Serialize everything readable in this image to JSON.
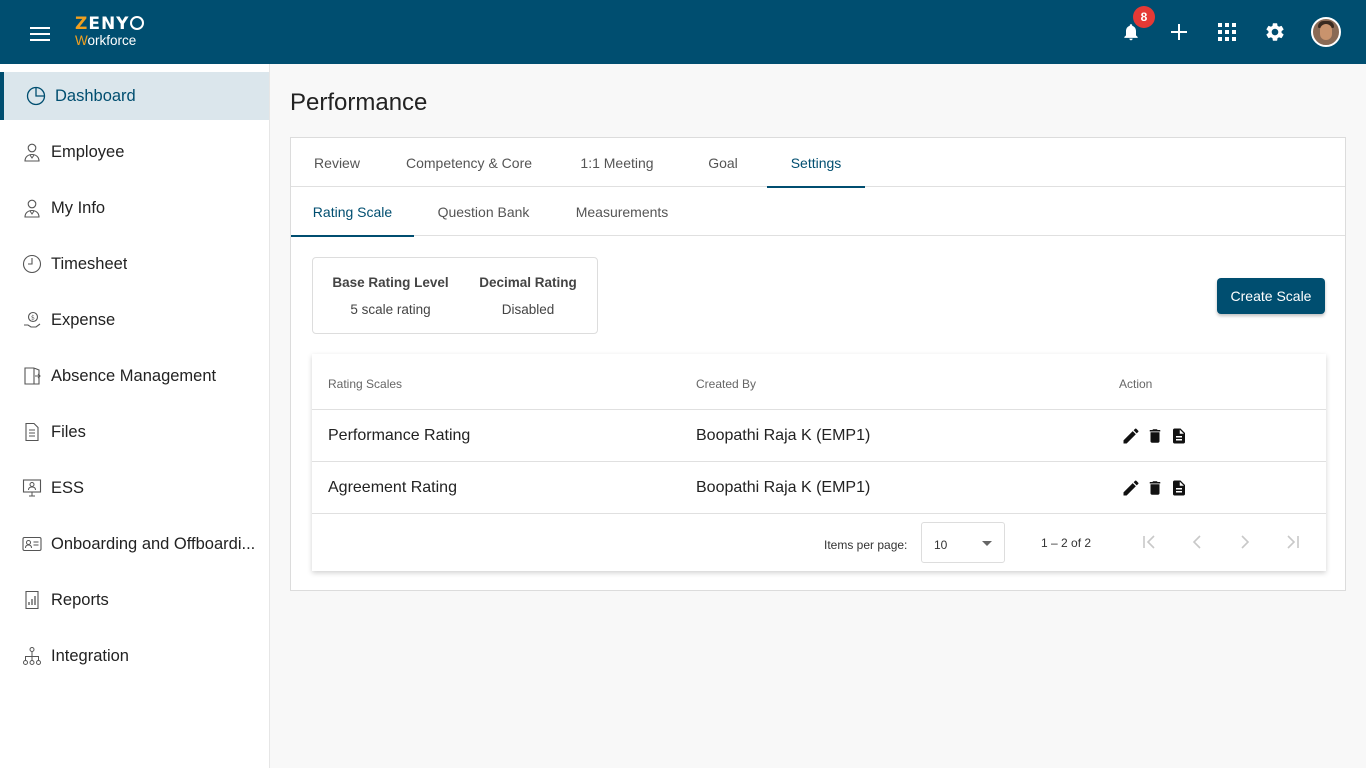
{
  "app": {
    "logo_main": "ZENY",
    "logo_sub": "Workforce",
    "notification_count": "8"
  },
  "sidebar": {
    "items": [
      {
        "label": "Dashboard",
        "icon": "pie-chart-icon",
        "active": true
      },
      {
        "label": "Employee",
        "icon": "person-icon"
      },
      {
        "label": "My Info",
        "icon": "person-icon"
      },
      {
        "label": "Timesheet",
        "icon": "clock-icon"
      },
      {
        "label": "Expense",
        "icon": "money-hand-icon"
      },
      {
        "label": "Absence Management",
        "icon": "exit-door-icon"
      },
      {
        "label": "Files",
        "icon": "file-icon"
      },
      {
        "label": "ESS",
        "icon": "monitor-user-icon"
      },
      {
        "label": "Onboarding and Offboardi...",
        "icon": "id-card-icon"
      },
      {
        "label": "Reports",
        "icon": "report-icon"
      },
      {
        "label": "Integration",
        "icon": "hierarchy-icon"
      }
    ]
  },
  "page": {
    "title": "Performance",
    "tabs": [
      "Review",
      "Competency & Core",
      "1:1 Meeting",
      "Goal",
      "Settings"
    ],
    "active_tab": "Settings",
    "subtabs": [
      "Rating Scale",
      "Question Bank",
      "Measurements"
    ],
    "active_subtab": "Rating Scale"
  },
  "info": {
    "base_rating_label": "Base Rating Level",
    "base_rating_value": "5 scale rating",
    "decimal_label": "Decimal Rating",
    "decimal_value": "Disabled"
  },
  "create_button": "Create Scale",
  "table": {
    "headers": [
      "Rating Scales",
      "Created By",
      "Action"
    ],
    "rows": [
      {
        "scale": "Performance Rating",
        "created_by": "Boopathi Raja K (EMP1)"
      },
      {
        "scale": "Agreement Rating",
        "created_by": "Boopathi Raja K (EMP1)"
      }
    ]
  },
  "paginator": {
    "items_per_page_label": "Items per page:",
    "items_per_page": "10",
    "range": "1 – 2 of 2"
  }
}
